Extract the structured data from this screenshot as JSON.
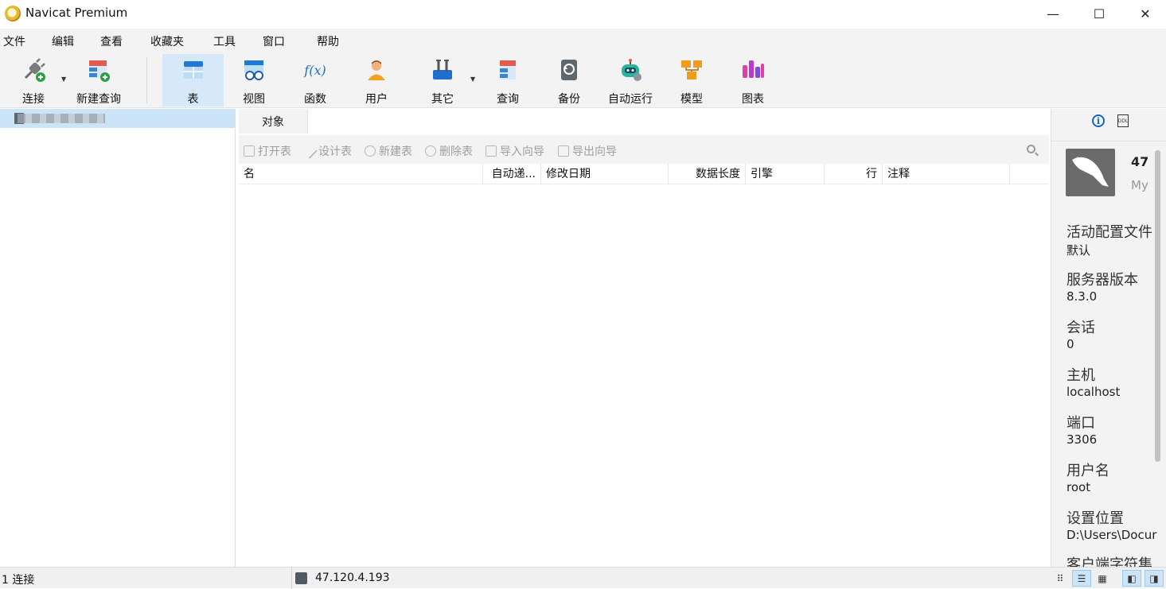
{
  "window": {
    "title": "Navicat Premium",
    "minimize_glyph": "—",
    "maximize_glyph": "☐",
    "close_glyph": "✕"
  },
  "menu": [
    "文件",
    "编辑",
    "查看",
    "收藏夹",
    "工具",
    "窗口",
    "帮助"
  ],
  "toolbar": {
    "buttons": [
      {
        "label": "连接",
        "icon": "plug-connect-icon"
      },
      {
        "label": "新建查询",
        "icon": "new-query-icon"
      },
      {
        "label": "表",
        "icon": "table-icon"
      },
      {
        "label": "视图",
        "icon": "view-glasses-icon"
      },
      {
        "label": "函数",
        "icon": "function-fx-icon",
        "glyph": "f(x)"
      },
      {
        "label": "用户",
        "icon": "user-icon"
      },
      {
        "label": "其它",
        "icon": "tools-icon"
      },
      {
        "label": "查询",
        "icon": "query-icon"
      },
      {
        "label": "备份",
        "icon": "backup-icon"
      },
      {
        "label": "自动运行",
        "icon": "robot-icon"
      },
      {
        "label": "模型",
        "icon": "model-icon"
      },
      {
        "label": "图表",
        "icon": "chart-icon"
      }
    ],
    "active": "表"
  },
  "object_tabs": {
    "tab": "对象"
  },
  "object_toolbar": {
    "open_table": "打开表",
    "design_table": "设计表",
    "new_table": "新建表",
    "delete_table": "删除表",
    "import_wizard": "导入向导",
    "export_wizard": "导出向导"
  },
  "grid": {
    "columns": [
      "名",
      "自动递...",
      "修改日期",
      "数据长度",
      "引擎",
      "行",
      "注释"
    ],
    "rows": []
  },
  "info_panel": {
    "name": "47",
    "subtitle": "My",
    "fields": [
      {
        "label": "活动配置文件",
        "value": "默认"
      },
      {
        "label": "服务器版本",
        "value": "8.3.0"
      },
      {
        "label": "会话",
        "value": "0"
      },
      {
        "label": "主机",
        "value": "localhost"
      },
      {
        "label": "端口",
        "value": "3306"
      },
      {
        "label": "用户名",
        "value": "root"
      },
      {
        "label": "设置位置",
        "value": "D:\\Users\\Docur"
      },
      {
        "label": "客户端字符集",
        "value": ""
      }
    ]
  },
  "status": {
    "connections": "1 连接",
    "server": "47.120.4.193"
  },
  "colors": {
    "accent": "#0078d4",
    "selection": "#cce4f7",
    "toolbar_bg": "#f3f3f3"
  }
}
